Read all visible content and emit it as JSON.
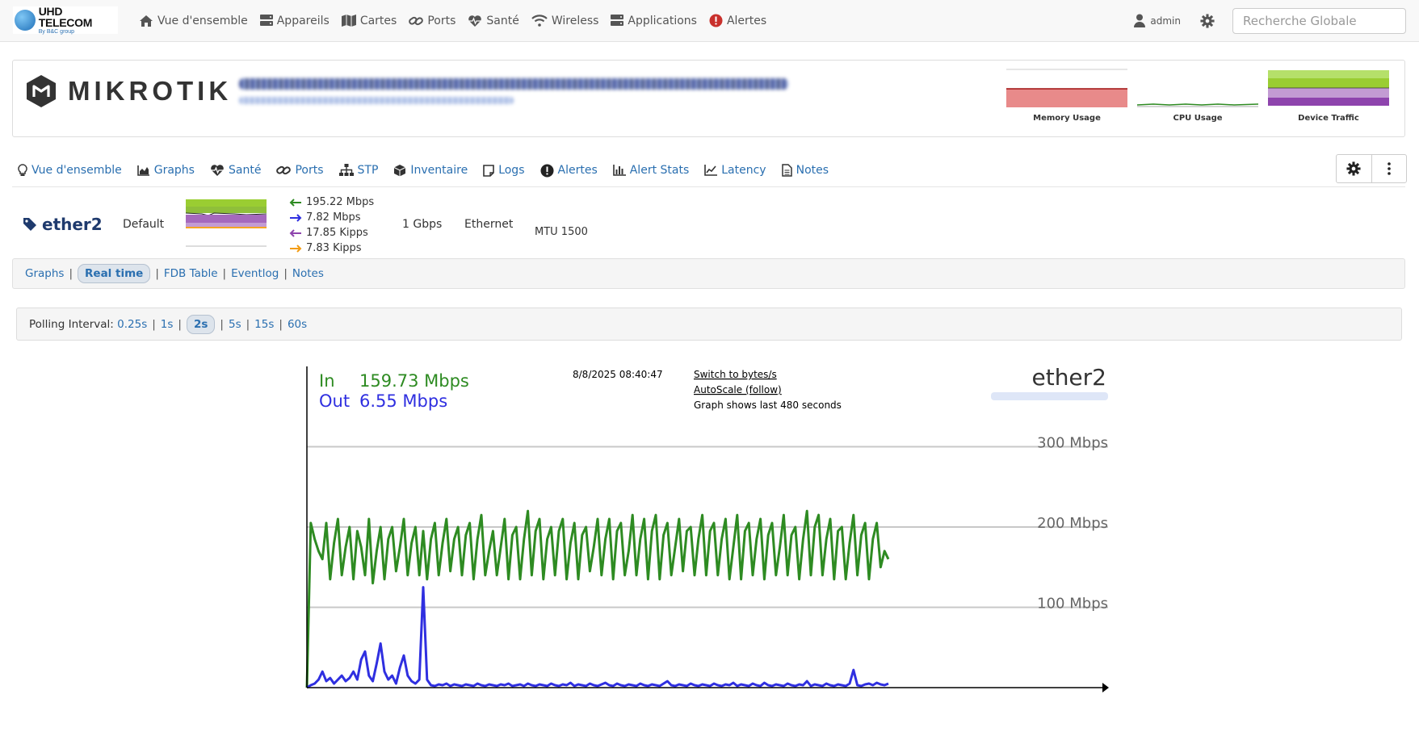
{
  "brand": {
    "name": "UHD TELECOM",
    "sub": "By B&C group"
  },
  "topnav": {
    "items": [
      {
        "label": "Vue d'ensemble",
        "icon": "home-icon"
      },
      {
        "label": "Appareils",
        "icon": "server-icon"
      },
      {
        "label": "Cartes",
        "icon": "map-icon"
      },
      {
        "label": "Ports",
        "icon": "link-icon"
      },
      {
        "label": "Santé",
        "icon": "heartbeat-icon"
      },
      {
        "label": "Wireless",
        "icon": "wifi-icon"
      },
      {
        "label": "Applications",
        "icon": "server-icon"
      },
      {
        "label": "Alertes",
        "icon": "alert-icon"
      }
    ],
    "user": "admin",
    "search_placeholder": "Recherche Globale"
  },
  "device": {
    "vendor_logo": "MIKROTIK",
    "mini_graphs": [
      "Memory Usage",
      "CPU Usage",
      "Device Traffic"
    ]
  },
  "subnav": {
    "items": [
      {
        "label": "Vue d'ensemble",
        "icon": "lightbulb-icon"
      },
      {
        "label": "Graphs",
        "icon": "area-chart-icon"
      },
      {
        "label": "Santé",
        "icon": "heartbeat-icon"
      },
      {
        "label": "Ports",
        "icon": "link-icon"
      },
      {
        "label": "STP",
        "icon": "sitemap-icon"
      },
      {
        "label": "Inventaire",
        "icon": "cube-icon"
      },
      {
        "label": "Logs",
        "icon": "note-icon"
      },
      {
        "label": "Alertes",
        "icon": "alert-icon"
      },
      {
        "label": "Alert Stats",
        "icon": "bar-chart-icon"
      },
      {
        "label": "Latency",
        "icon": "line-chart-icon"
      },
      {
        "label": "Notes",
        "icon": "file-icon"
      }
    ]
  },
  "port": {
    "name": "ether2",
    "vlan": "Default",
    "in_bps": "195.22 Mbps",
    "out_bps": "7.82 Mbps",
    "in_pps": "17.85 Kipps",
    "out_pps": "7.83 Kipps",
    "speed": "1 Gbps",
    "type": "Ethernet",
    "mtu": "MTU 1500"
  },
  "port_tabs": [
    "Graphs",
    "Real time",
    "FDB Table",
    "Eventlog",
    "Notes"
  ],
  "port_tabs_active": "Real time",
  "polling": {
    "label": "Polling Interval:",
    "options": [
      "0.25s",
      "1s",
      "2s",
      "5s",
      "15s",
      "60s"
    ],
    "active": "2s"
  },
  "colors": {
    "in": "#2e8b22",
    "out": "#2f2fe0",
    "link": "#2a6fb0",
    "memory": "#e88a8a",
    "traffic_in": "#9acd32",
    "traffic_out": "#9b59b6"
  },
  "chart_data": {
    "type": "line",
    "title": "ether2",
    "in_label": "In",
    "in_value": "159.73 Mbps",
    "out_label": "Out",
    "out_value": "6.55 Mbps",
    "timestamp": "8/8/2025 08:40:47",
    "switch_link": "Switch to bytes/s",
    "autoscale_link": "AutoScale (follow)",
    "range_text": "Graph shows last 480 seconds",
    "y_ticks": [
      {
        "value": 100,
        "label": "100 Mbps"
      },
      {
        "value": 200,
        "label": "200 Mbps"
      },
      {
        "value": 300,
        "label": "300 Mbps"
      }
    ],
    "ylim": [
      0,
      400
    ],
    "x_label": "",
    "series": [
      {
        "name": "In",
        "color": "#2e8b22",
        "values": [
          0,
          205,
          185,
          170,
          160,
          205,
          135,
          180,
          210,
          140,
          175,
          200,
          135,
          195,
          175,
          140,
          210,
          130,
          170,
          200,
          135,
          185,
          200,
          145,
          175,
          210,
          140,
          180,
          200,
          140,
          195,
          135,
          185,
          205,
          140,
          180,
          210,
          145,
          185,
          200,
          140,
          190,
          205,
          135,
          185,
          215,
          140,
          170,
          195,
          140,
          175,
          210,
          135,
          190,
          200,
          135,
          185,
          220,
          140,
          195,
          210,
          135,
          185,
          200,
          140,
          195,
          210,
          135,
          180,
          205,
          135,
          190,
          200,
          145,
          175,
          210,
          140,
          185,
          210,
          135,
          195,
          205,
          140,
          170,
          215,
          140,
          185,
          210,
          135,
          195,
          215,
          135,
          190,
          205,
          140,
          175,
          210,
          145,
          195,
          200,
          140,
          185,
          215,
          140,
          195,
          205,
          140,
          185,
          210,
          135,
          175,
          215,
          135,
          195,
          205,
          140,
          185,
          210,
          135,
          190,
          205,
          140,
          175,
          215,
          140,
          190,
          200,
          135,
          185,
          220,
          140,
          200,
          215,
          140,
          185,
          210,
          135,
          195,
          200,
          135,
          180,
          215,
          140,
          190,
          205,
          135,
          185,
          205,
          150,
          170,
          160
        ],
        "note": ""
      },
      {
        "name": "Out",
        "color": "#2f2fe0",
        "values": [
          0,
          3,
          5,
          10,
          20,
          8,
          12,
          5,
          10,
          15,
          8,
          12,
          20,
          10,
          35,
          45,
          15,
          8,
          30,
          55,
          20,
          10,
          15,
          5,
          25,
          40,
          15,
          8,
          5,
          10,
          125,
          10,
          3,
          2,
          4,
          3,
          5,
          2,
          4,
          3,
          2,
          4,
          3,
          2,
          5,
          3,
          2,
          4,
          3,
          2,
          4,
          3,
          5,
          2,
          3,
          4,
          2,
          5,
          3,
          2,
          4,
          3,
          2,
          5,
          3,
          2,
          4,
          3,
          6,
          2,
          4,
          3,
          2,
          5,
          3,
          2,
          4,
          6,
          3,
          2,
          5,
          3,
          2,
          4,
          3,
          2,
          5,
          3,
          2,
          4,
          3,
          2,
          5,
          8,
          3,
          2,
          4,
          3,
          2,
          5,
          3,
          2,
          4,
          3,
          2,
          5,
          3,
          2,
          4,
          3,
          6,
          2,
          4,
          3,
          2,
          5,
          3,
          2,
          6,
          3,
          2,
          4,
          3,
          2,
          5,
          3,
          2,
          4,
          3,
          8,
          2,
          4,
          3,
          2,
          5,
          3,
          2,
          4,
          3,
          2,
          5,
          22,
          3,
          2,
          4,
          5,
          3,
          6,
          4,
          3,
          5
        ],
        "note": ""
      }
    ]
  }
}
